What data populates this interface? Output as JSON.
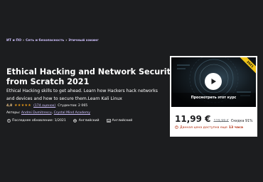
{
  "breadcrumb": {
    "items": [
      "ИТ и ПО",
      "Сеть и безопасность",
      "Этичный хакинг"
    ],
    "separator": "›"
  },
  "course": {
    "title_lines": [
      "Ethical Hacking and Network Security",
      "from Scratch 2021"
    ],
    "subtitle_lines": [
      "Ethical Hacking skills to get ahead. Learn how Hackers hack networks",
      "and devices and how to secure them.Learn Kali Linux"
    ],
    "rating": {
      "value": "4,8",
      "stars": 4.8,
      "count_text": "(174 оценок)",
      "students_text": "Студентов: 2 065"
    },
    "authors": {
      "label": "Авторы:",
      "names": [
        "Andrei Dumitrescu",
        "Crystal Mind Academy"
      ]
    },
    "meta": {
      "updated": "Последнее обновление: 1/2021",
      "language": "Английский",
      "captions": "Английский"
    }
  },
  "sidebar": {
    "preview_label": "Просмотреть этот курс",
    "year_badge": "2021",
    "price_current": "11,99 €",
    "price_original": "129,99 €",
    "discount": "Скидка 91%",
    "deadline_prefix": "Данная цена доступна еще",
    "deadline_hours": "13 часа"
  },
  "colors": {
    "background": "#1c1d1f",
    "link_purple": "#cec0fc",
    "rating_gold": "#f3ca8c",
    "star_orange": "#e59819",
    "deadline_red": "#b32d0f",
    "badge_yellow": "#f0c419"
  }
}
